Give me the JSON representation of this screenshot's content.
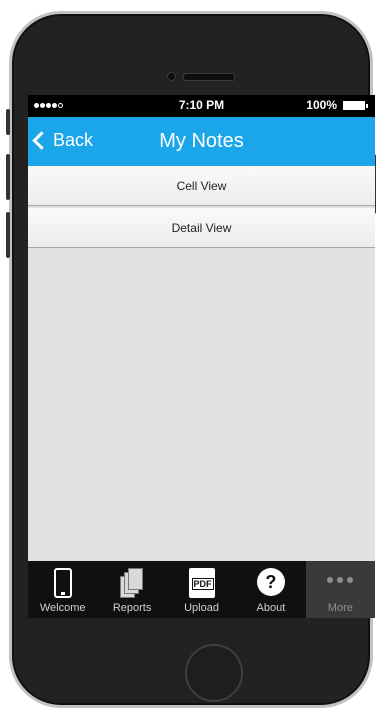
{
  "status_bar": {
    "time": "7:10 PM",
    "battery": "100%"
  },
  "nav": {
    "back_label": "Back",
    "title": "My Notes"
  },
  "list": [
    {
      "label": "Cell View"
    },
    {
      "label": "Detail View"
    }
  ],
  "tabs": [
    {
      "label": "Welcome",
      "icon": "phone-icon"
    },
    {
      "label": "Reports",
      "icon": "documents-icon"
    },
    {
      "label": "Upload",
      "icon": "pdf-icon",
      "icon_text": "PDF"
    },
    {
      "label": "About",
      "icon": "question-icon",
      "icon_text": "?"
    },
    {
      "label": "More",
      "icon": "more-dots-icon",
      "active": true
    }
  ],
  "colors": {
    "navbar": "#1aa6e8",
    "tabbar": "#101010",
    "content": "#e1e1e1"
  }
}
